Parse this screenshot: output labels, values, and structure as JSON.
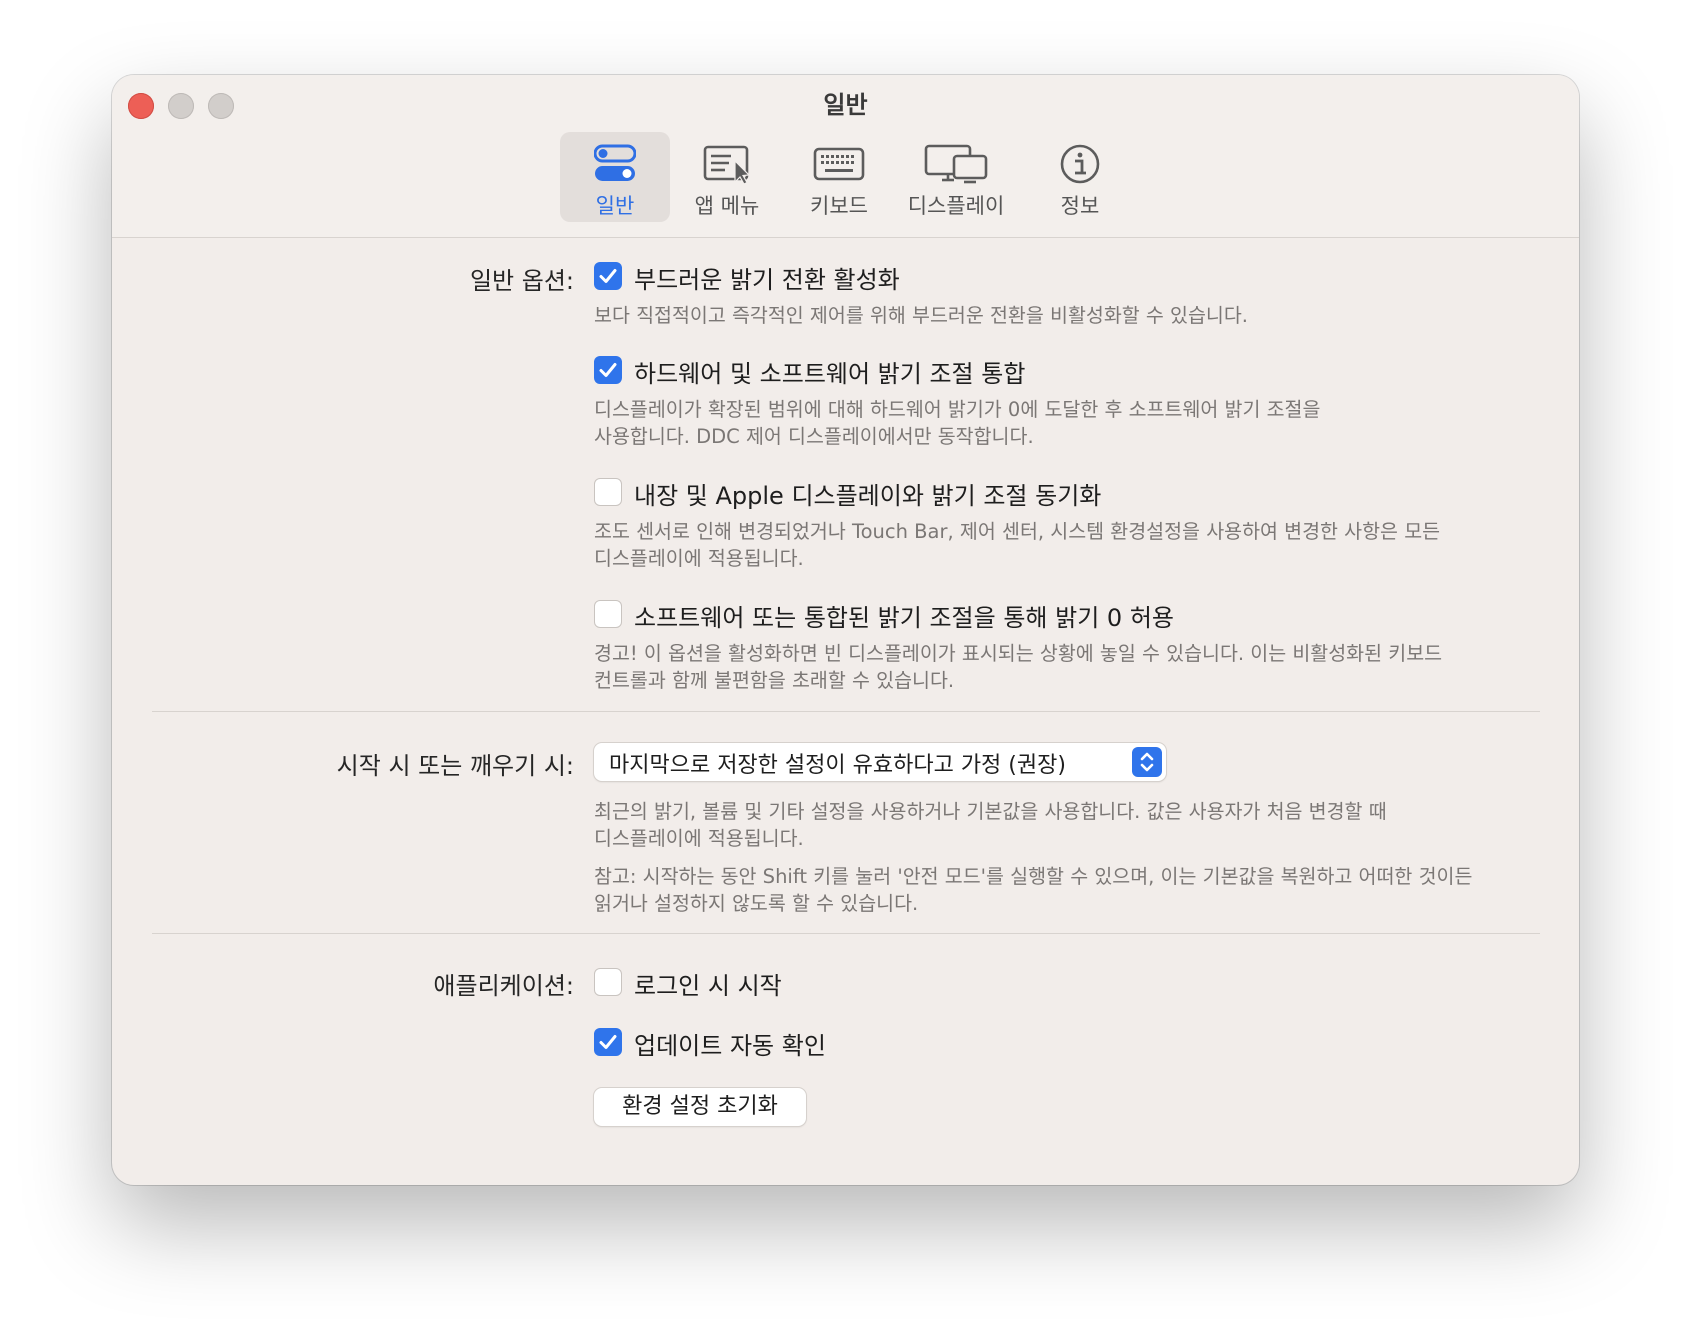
{
  "window": {
    "title": "일반"
  },
  "toolbar": {
    "tabs": [
      {
        "id": "general",
        "label": "일반",
        "icon": "toggle-switches-icon",
        "active": true
      },
      {
        "id": "app-menu",
        "label": "앱 메뉴",
        "icon": "menu-cursor-icon",
        "active": false
      },
      {
        "id": "keyboard",
        "label": "키보드",
        "icon": "keyboard-icon",
        "active": false
      },
      {
        "id": "display",
        "label": "디스플레이",
        "icon": "displays-icon",
        "active": false
      },
      {
        "id": "info",
        "label": "정보",
        "icon": "info-icon",
        "active": false
      }
    ]
  },
  "general_options": {
    "label": "일반 옵션:",
    "options": [
      {
        "label": "부드러운 밝기 전환 활성화",
        "checked": true,
        "desc": [
          "보다 직접적이고 즉각적인 제어를 위해 부드러운 전환을 비활성화할 수 있습니다."
        ]
      },
      {
        "label": "하드웨어 및 소프트웨어 밝기 조절 통합",
        "checked": true,
        "desc": [
          "디스플레이가 확장된 범위에 대해 하드웨어 밝기가 0에 도달한 후 소프트웨어 밝기 조절을",
          "사용합니다. DDC 제어 디스플레이에서만 동작합니다."
        ]
      },
      {
        "label": "내장 및 Apple 디스플레이와 밝기 조절 동기화",
        "checked": false,
        "desc": [
          "조도 센서로 인해 변경되었거나 Touch Bar, 제어 센터, 시스템 환경설정을 사용하여 변경한 사항은 모든",
          "디스플레이에 적용됩니다."
        ]
      },
      {
        "label": "소프트웨어 또는 통합된 밝기 조절을 통해 밝기 0 허용",
        "checked": false,
        "desc": [
          "경고! 이 옵션을 활성화하면 빈 디스플레이가 표시되는 상황에 놓일 수 있습니다. 이는 비활성화된 키보드",
          "컨트롤과 함께 불편함을 초래할 수 있습니다."
        ]
      }
    ]
  },
  "startup": {
    "label": "시작 시 또는 깨우기 시:",
    "selected": "마지막으로 저장한 설정이 유효하다고 가정 (권장)",
    "desc1": [
      "최근의 밝기, 볼륨 및 기타 설정을 사용하거나 기본값을 사용합니다. 값은 사용자가 처음 변경할 때",
      "디스플레이에 적용됩니다."
    ],
    "desc2": [
      "참고: 시작하는 동안 Shift 키를 눌러 '안전 모드'를 실행할 수 있으며, 이는 기본값을 복원하고 어떠한 것이든",
      "읽거나 설정하지 않도록 할 수 있습니다."
    ]
  },
  "application": {
    "label": "애플리케이션:",
    "options": [
      {
        "label": "로그인 시 시작",
        "checked": false
      },
      {
        "label": "업데이트 자동 확인",
        "checked": true
      }
    ],
    "reset_button": "환경 설정 초기화"
  },
  "colors": {
    "accent": "#2f74eb",
    "close": "#ed5f56",
    "background": "#f2edea"
  }
}
